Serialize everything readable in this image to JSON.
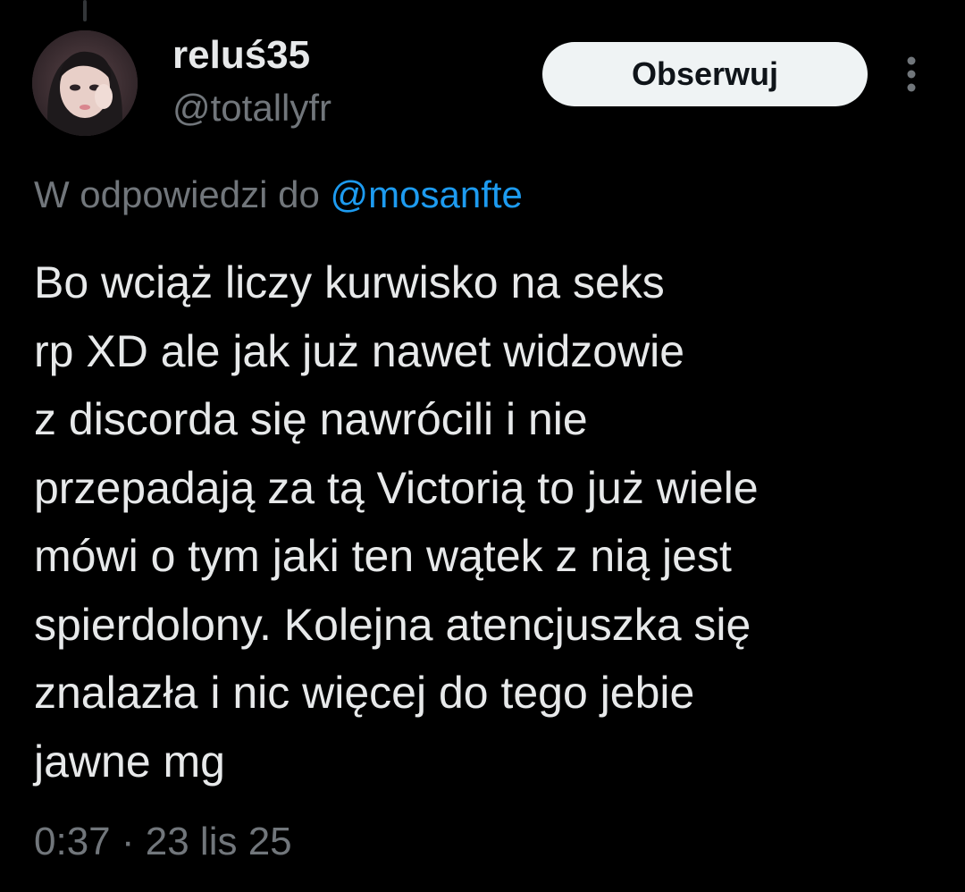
{
  "author": {
    "display_name": "reluś35",
    "handle": "@totallyfr",
    "avatar_icon": "profile-photo"
  },
  "actions": {
    "follow_label": "Obserwuj",
    "more_icon": "more-vertical-icon"
  },
  "reply_context": {
    "prefix": "W odpowiedzi do",
    "mention": "@mosanfte"
  },
  "tweet": {
    "lines": [
      "Bo wciąż liczy kurwisko na seks",
      "rp XD ale jak już nawet widzowie",
      "z discorda się nawrócili i nie",
      "przepadają za tą Victorią to już wiele",
      "mówi o tym jaki ten wątek z nią jest",
      "spierdolony. Kolejna atencjuszka się",
      "znalazła i nic więcej do tego jebie",
      "jawne mg"
    ]
  },
  "meta": {
    "time": "0:37",
    "separator": "·",
    "date": "23 lis 25"
  },
  "colors": {
    "background": "#000000",
    "text_primary": "#e7e9ea",
    "text_secondary": "#71767b",
    "link": "#1d9bf0",
    "button_bg": "#eff3f4",
    "button_text": "#0f1419"
  }
}
